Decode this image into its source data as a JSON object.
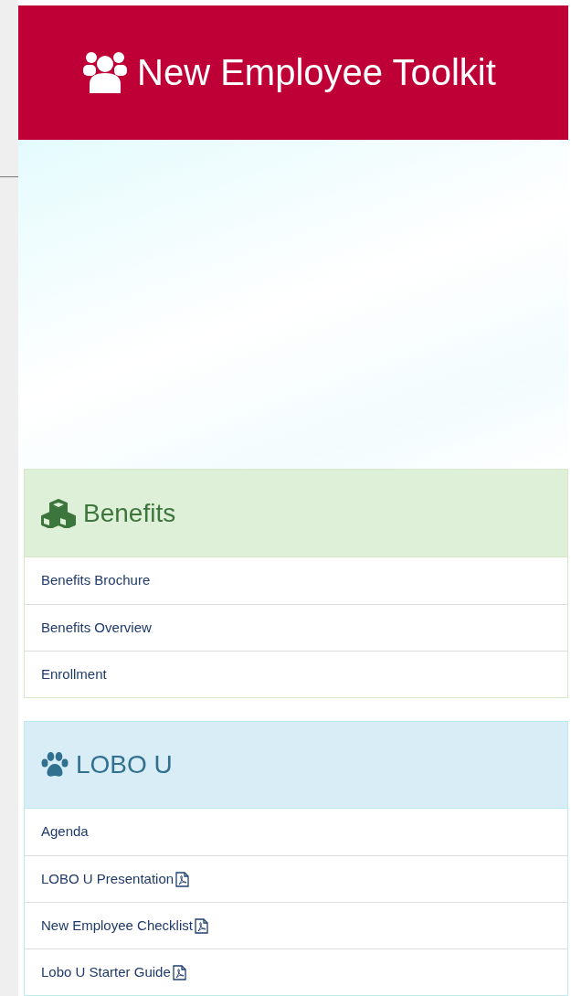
{
  "header": {
    "title": "New Employee Toolkit"
  },
  "panels": [
    {
      "kind": "benefits",
      "title": "Benefits",
      "items": [
        {
          "label": "Benefits Brochure",
          "pdf": false
        },
        {
          "label": "Benefits Overview",
          "pdf": false
        },
        {
          "label": "Enrollment",
          "pdf": false
        }
      ]
    },
    {
      "kind": "lobo",
      "title": "LOBO U",
      "items": [
        {
          "label": "Agenda",
          "pdf": false
        },
        {
          "label": "LOBO U Presentation",
          "pdf": true
        },
        {
          "label": "New Employee Checklist",
          "pdf": true
        },
        {
          "label": "Lobo U Starter Guide",
          "pdf": true
        }
      ]
    }
  ]
}
